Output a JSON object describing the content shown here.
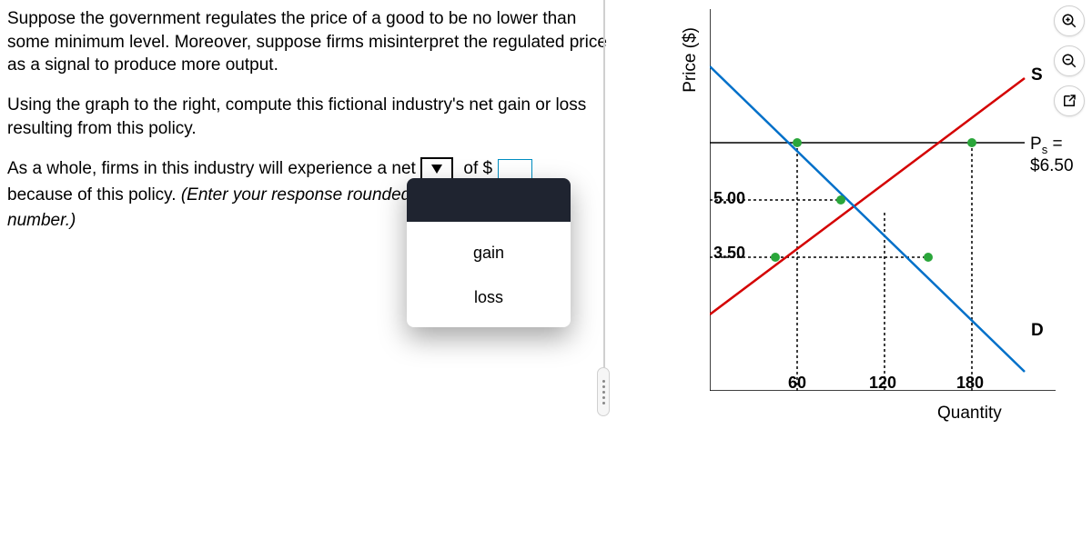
{
  "question": {
    "p1": "Suppose the government regulates the price of a good to be no lower than some minimum level. Moreover, suppose firms misinterpret the regulated price as a signal to produce more output.",
    "p2": "Using the graph to the right, compute this fictional industry's net gain or loss resulting from this policy.",
    "answer_prefix": "As a whole, firms in this industry will experience a net",
    "of_text": "of $",
    "answer_suffix1": "because of this policy. ",
    "answer_suffix2": "(Enter your  response rounded to the nearest whole number.)"
  },
  "dropdown": {
    "options": [
      "gain",
      "loss"
    ]
  },
  "chart": {
    "ylabel": "Price ($)",
    "xlabel": "Quantity",
    "s_label": "S",
    "d_label": "D",
    "ps_label_prefix": "P",
    "ps_label_sub": "s",
    "ps_label_eq": " = $6.50",
    "yticks": [
      "5.00",
      "3.50"
    ],
    "xticks": [
      "60",
      "120",
      "180"
    ]
  },
  "chart_data": {
    "type": "line",
    "xlabel": "Quantity",
    "ylabel": "Price ($)",
    "xlim": [
      0,
      240
    ],
    "ylim": [
      0,
      10
    ],
    "series": [
      {
        "name": "S",
        "x": [
          0,
          240
        ],
        "y": [
          2,
          10
        ],
        "color": "#d40000"
      },
      {
        "name": "D",
        "x": [
          0,
          240
        ],
        "y": [
          8.5,
          0.5
        ],
        "color": "#0070c9"
      }
    ],
    "price_floor_Ps": 6.5,
    "reference_prices": [
      5.0,
      3.5
    ],
    "reference_quantities": [
      60,
      120,
      180
    ],
    "marked_points": [
      {
        "x": 60,
        "y": 6.5
      },
      {
        "x": 90,
        "y": 5.0
      },
      {
        "x": 180,
        "y": 6.5
      },
      {
        "x": 45,
        "y": 3.5
      },
      {
        "x": 150,
        "y": 3.5
      }
    ]
  }
}
